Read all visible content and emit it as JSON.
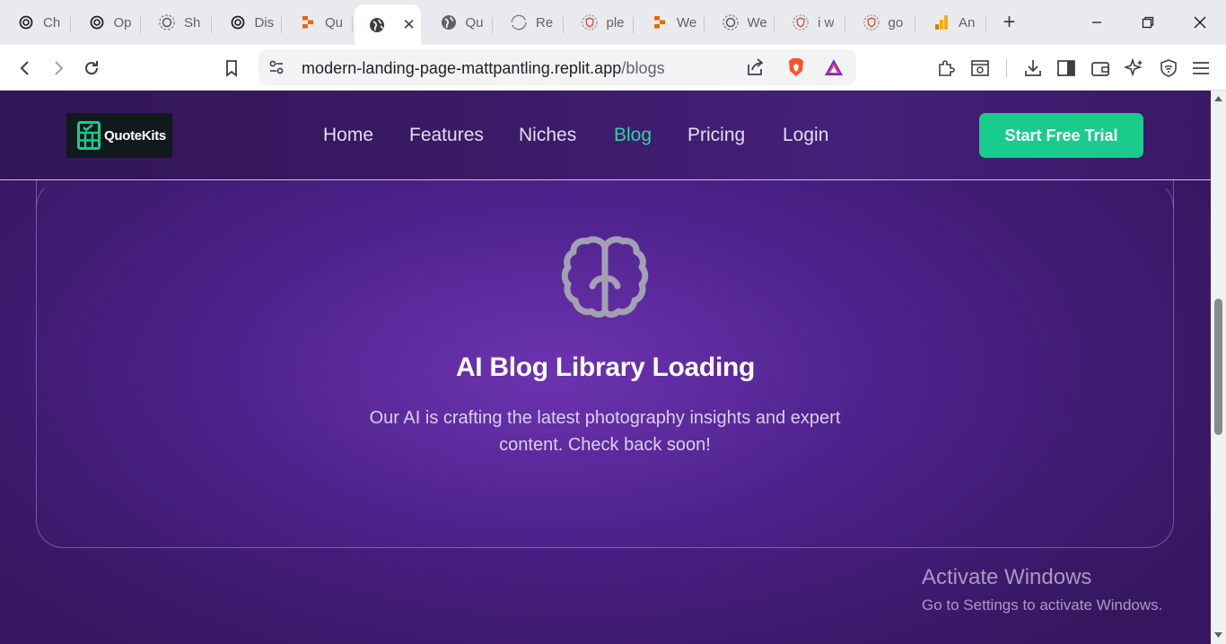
{
  "browser": {
    "tabs": [
      {
        "title": "Ch",
        "icon": "openai-icon"
      },
      {
        "title": "Op",
        "icon": "openai-icon"
      },
      {
        "title": "Sh",
        "icon": "openai-dashed-icon"
      },
      {
        "title": "Dis",
        "icon": "openai-icon"
      },
      {
        "title": "Qu",
        "icon": "replit-icon"
      },
      {
        "title": "",
        "icon": "globe-icon",
        "active": true
      },
      {
        "title": "Qu",
        "icon": "globe-icon"
      },
      {
        "title": "Re",
        "icon": "loading-icon"
      },
      {
        "title": "ple",
        "icon": "brave-icon"
      },
      {
        "title": "We",
        "icon": "replit-icon"
      },
      {
        "title": "We",
        "icon": "openai-dashed-icon"
      },
      {
        "title": "i w",
        "icon": "brave-icon"
      },
      {
        "title": "go",
        "icon": "brave-icon"
      },
      {
        "title": "An",
        "icon": "analytics-icon"
      }
    ],
    "new_tab_label": "+",
    "close_tab_label": "✕",
    "url": {
      "host": "modern-landing-page-mattpantling.replit.app",
      "path": "/blogs"
    }
  },
  "site": {
    "logo_text": "QuoteKits",
    "nav": {
      "home": "Home",
      "features": "Features",
      "niches": "Niches",
      "blog": "Blog",
      "pricing": "Pricing",
      "login": "Login"
    },
    "cta_label": "Start Free Trial",
    "card": {
      "icon": "brain-icon",
      "title": "AI Blog Library Loading",
      "description": "Our AI is crafting the latest photography insights and expert content. Check back soon!"
    },
    "colors": {
      "accent": "#19cc8b",
      "active_link": "#2dd4a2",
      "background": "#4a1f86"
    }
  },
  "os_watermark": {
    "title": "Activate Windows",
    "subtitle": "Go to Settings to activate Windows."
  }
}
